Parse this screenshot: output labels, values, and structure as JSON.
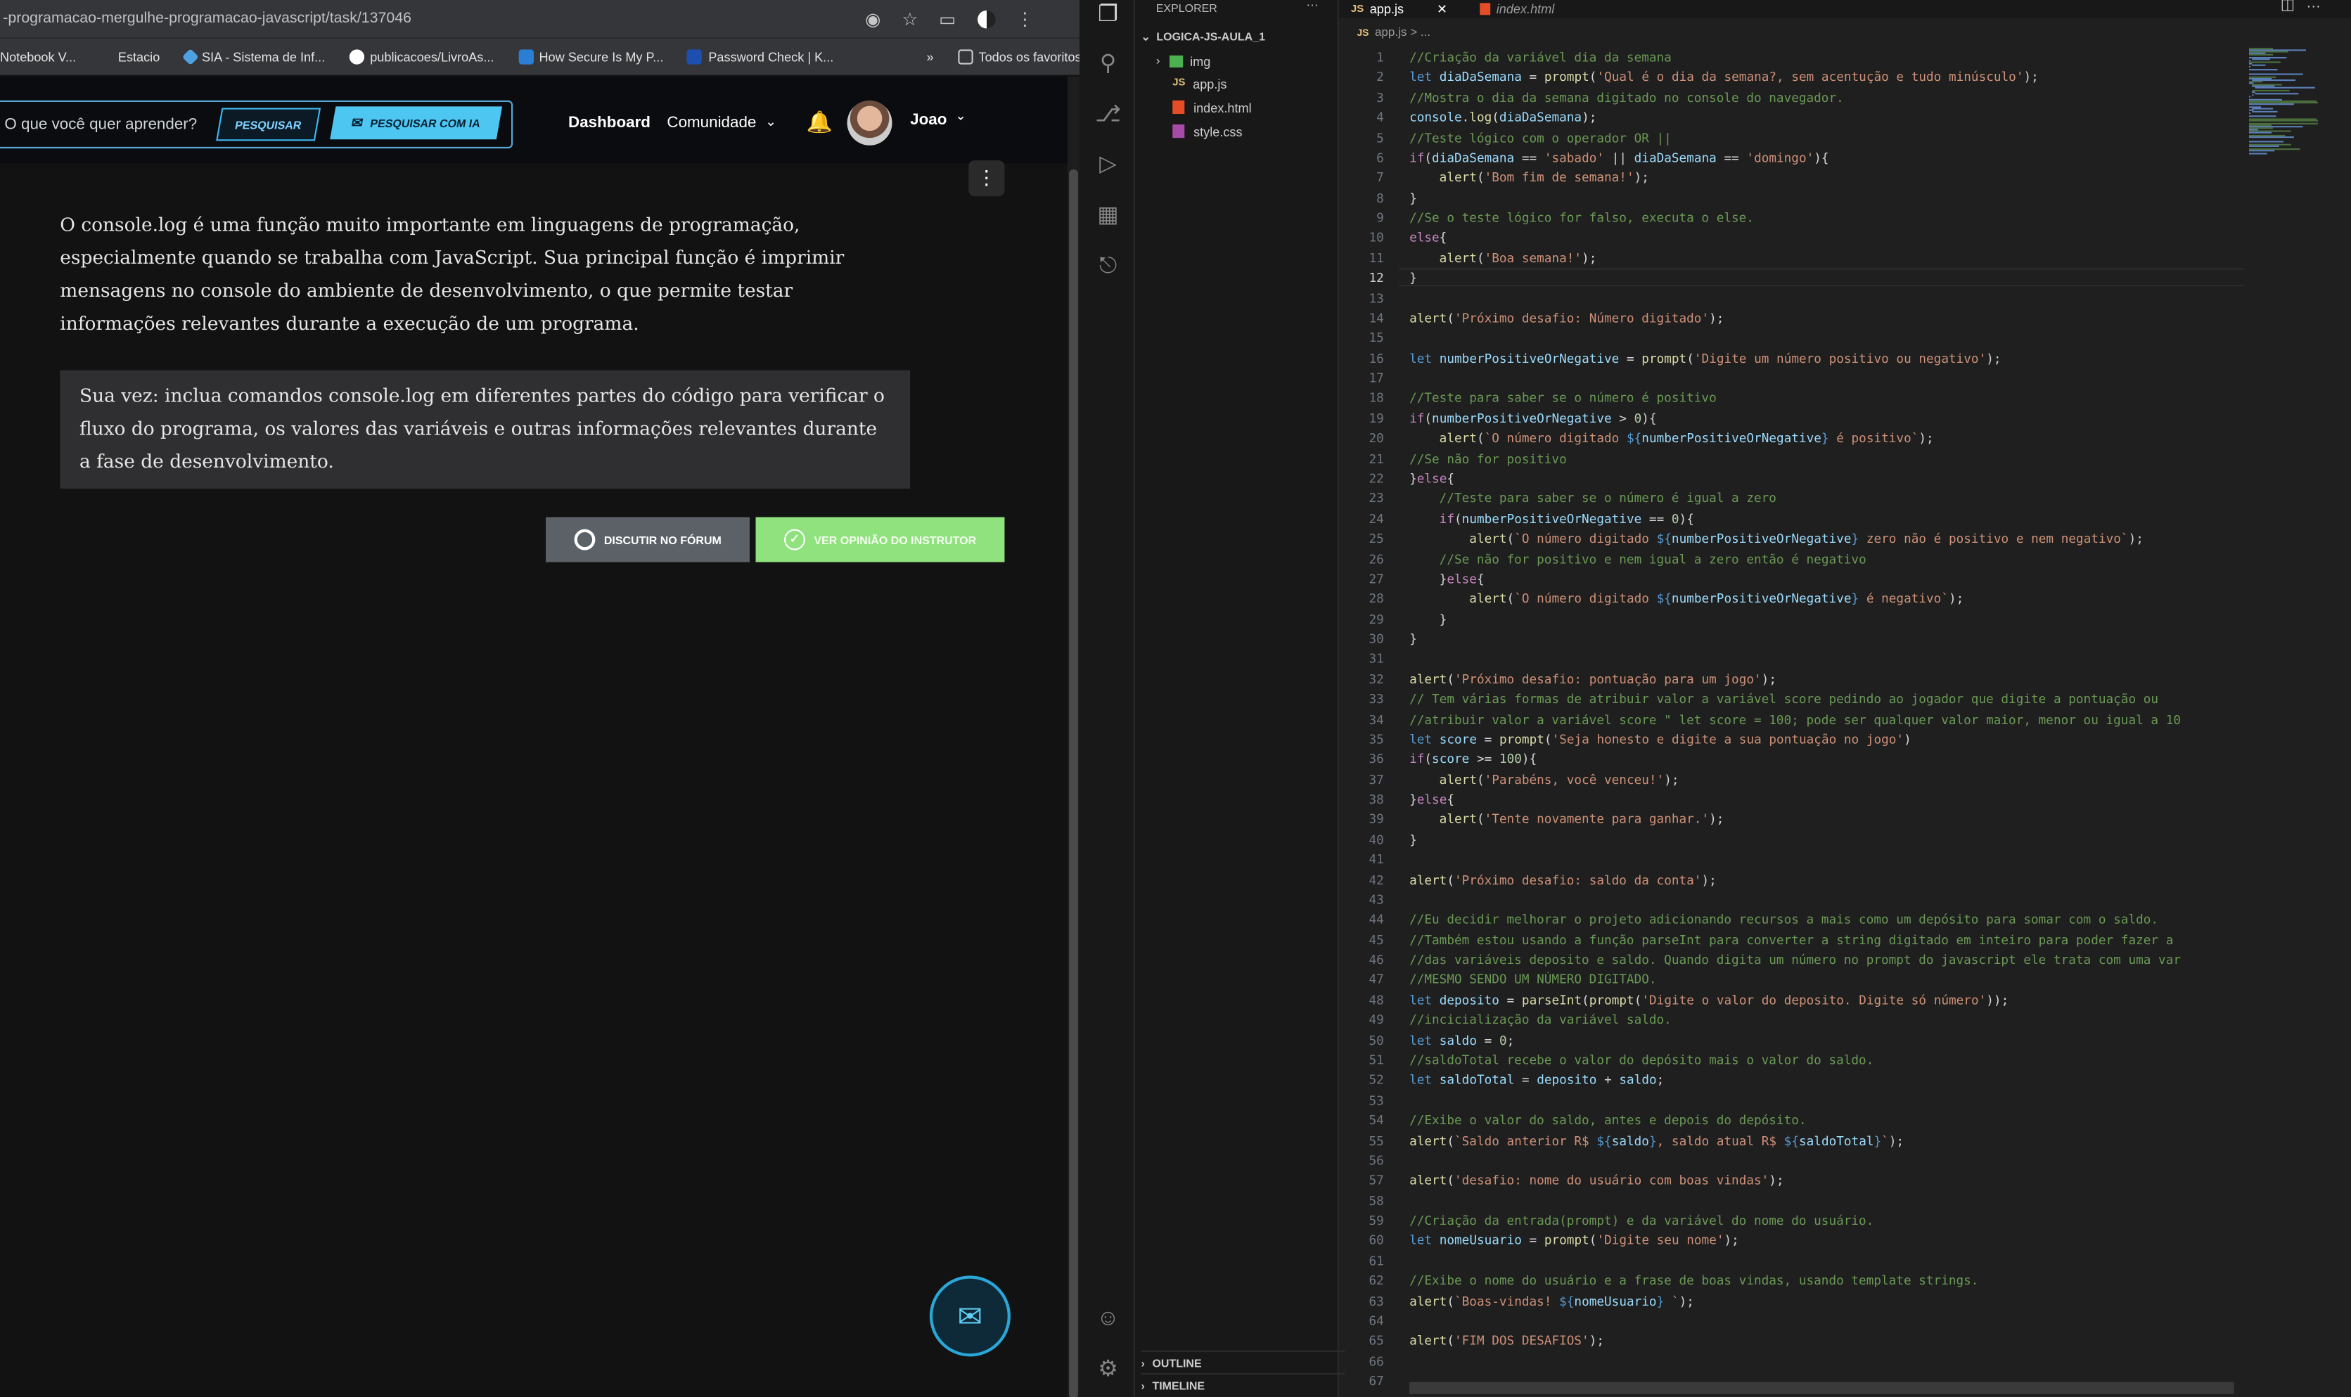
{
  "browser": {
    "url": "-programacao-mergulhe-programacao-javascript/task/137046",
    "bookmarks": [
      "Notebook V...",
      "Estacio",
      "SIA - Sistema de Inf...",
      "publicacoes/LivroAs...",
      "How Secure Is My P...",
      "Password Check | K..."
    ],
    "all_favorites": "Todos os favoritos"
  },
  "site": {
    "search_placeholder": "O que você quer aprender?",
    "search_button": "PESQUISAR",
    "ai_search_button": "PESQUISAR COM IA",
    "nav_dashboard": "Dashboard",
    "nav_comunidade": "Comunidade",
    "user_name": "Joao"
  },
  "task": {
    "paragraph": "O console.log é uma função muito importante em linguagens de programação, especialmente quando se trabalha com JavaScript. Sua principal função é imprimir mensagens no console do ambiente de desenvolvimento, o que permite testar informações relevantes durante a execução de um programa.",
    "tip": "Sua vez: inclua comandos console.log em diferentes partes do código para verificar o fluxo do programa, os valores das variáveis e outras informações relevantes durante a fase de desenvolvimento.",
    "forum_button": "DISCUTIR NO FÓRUM",
    "instructor_button": "VER OPINIÃO DO INSTRUTOR"
  },
  "vscode": {
    "explorer_title": "EXPLORER",
    "folder": "LOGICA-JS-AULA_1",
    "files": [
      {
        "name": "img",
        "type": "folder"
      },
      {
        "name": "app.js",
        "type": "js"
      },
      {
        "name": "index.html",
        "type": "html"
      },
      {
        "name": "style.css",
        "type": "css"
      }
    ],
    "outline": "OUTLINE",
    "timeline": "TIMELINE",
    "tabs": [
      {
        "label": "app.js",
        "active": true
      },
      {
        "label": "index.html",
        "active": false
      }
    ],
    "breadcrumb": "app.js > ...",
    "current_line": 12,
    "code_lines": [
      "//Criação da variável dia da semana",
      "let diaDaSemana = prompt('Qual é o dia da semana?, sem acentução e tudo minúsculo');",
      "//Mostra o dia da semana digitado no console do navegador.",
      "console.log(diaDaSemana);",
      "//Teste lógico com o operador OR ||",
      "if(diaDaSemana == 'sabado' || diaDaSemana == 'domingo'){",
      "    alert('Bom fim de semana!');",
      "}",
      "//Se o teste lógico for falso, executa o else.",
      "else{",
      "    alert('Boa semana!');",
      "}",
      "",
      "alert('Próximo desafio: Número digitado');",
      "",
      "let numberPositiveOrNegative = prompt('Digite um número positivo ou negativo');",
      "",
      "//Teste para saber se o número é positivo",
      "if(numberPositiveOrNegative > 0){",
      "    alert(`O número digitado ${numberPositiveOrNegative} é positivo`);",
      "//Se não for positivo",
      "}else{",
      "    //Teste para saber se o número é igual a zero",
      "    if(numberPositiveOrNegative == 0){",
      "        alert(`O número digitado ${numberPositiveOrNegative} zero não é positivo e nem negativo`);",
      "    //Se não for positivo e nem igual a zero então é negativo",
      "    }else{",
      "        alert(`O número digitado ${numberPositiveOrNegative} é negativo`);",
      "    }",
      "}",
      "",
      "alert('Próximo desafio: pontuação para um jogo');",
      "// Tem várias formas de atribuir valor a variável score pedindo ao jogador que digite a pontuação ou",
      "//atribuir valor a variável score \" let score = 100; pode ser qualquer valor maior, menor ou igual a 10",
      "let score = prompt('Seja honesto e digite a sua pontuação no jogo')",
      "if(score >= 100){",
      "    alert('Parabéns, você venceu!');",
      "}else{",
      "    alert('Tente novamente para ganhar.');",
      "}",
      "",
      "alert('Próximo desafio: saldo da conta');",
      "",
      "//Eu decidir melhorar o projeto adicionando recursos a mais como um depósito para somar com o saldo.",
      "//Também estou usando a função parseInt para converter a string digitado em inteiro para poder fazer a",
      "//das variáveis deposito e saldo. Quando digita um número no prompt do javascript ele trata com uma var",
      "//MESMO SENDO UM NÚMERO DIGITADO.",
      "let deposito = parseInt(prompt('Digite o valor do deposito. Digite só número'));",
      "//incicialização da variável saldo.",
      "let saldo = 0;",
      "//saldoTotal recebe o valor do depósito mais o valor do saldo.",
      "let saldoTotal = deposito + saldo;",
      "",
      "//Exibe o valor do saldo, antes e depois do depósito.",
      "alert(`Saldo anterior R$ ${saldo}, saldo atual R$ ${saldoTotal}`);",
      "",
      "alert('desafio: nome do usuário com boas vindas');",
      "",
      "//Criação da entrada(prompt) e da variável do nome do usuário.",
      "let nomeUsuario = prompt('Digite seu nome');",
      "",
      "//Exibe o nome do usuário e a frase de boas vindas, usando template strings.",
      "alert(`Boas-vindas! ${nomeUsuario} `);",
      "",
      "alert('FIM DOS DESAFIOS');",
      "",
      ""
    ]
  }
}
